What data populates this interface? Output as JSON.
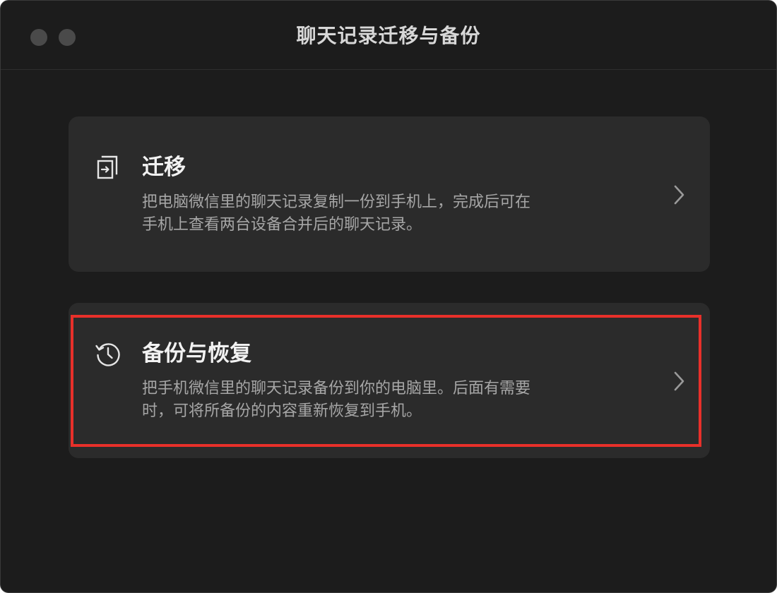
{
  "window": {
    "title": "聊天记录迁移与备份"
  },
  "colors": {
    "background": "#1c1c1c",
    "card": "#2b2b2b",
    "highlight": "#e8302a"
  },
  "options": [
    {
      "icon": "migrate-icon",
      "title": "迁移",
      "desc_line1": "把电脑微信里的聊天记录复制一份到手机上，完成后可在",
      "desc_line2": "手机上查看两台设备合并后的聊天记录。"
    },
    {
      "icon": "history-clock-icon",
      "title": "备份与恢复",
      "desc_line1": "把手机微信里的聊天记录备份到你的电脑里。后面有需要",
      "desc_line2": "时，可将所备份的内容重新恢复到手机。"
    }
  ]
}
